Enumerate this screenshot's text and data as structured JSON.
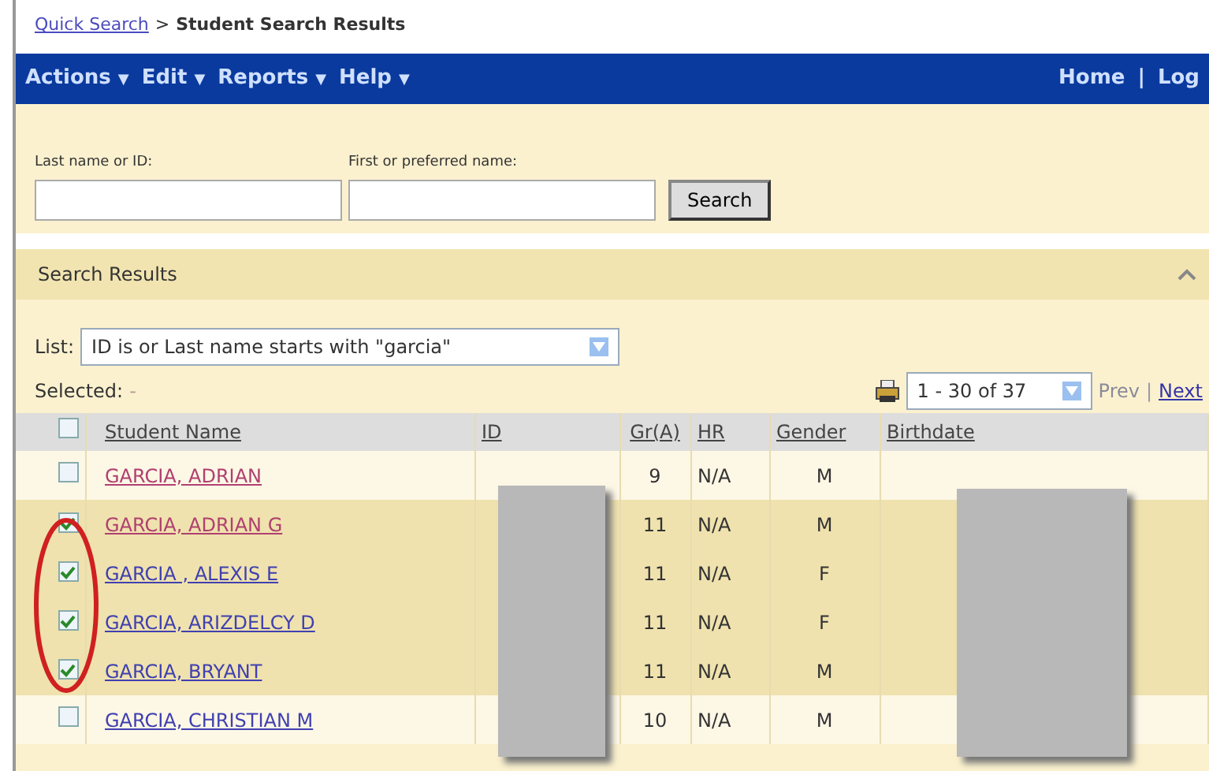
{
  "breadcrumb": {
    "link": "Quick Search",
    "separator": ">",
    "current": "Student Search Results"
  },
  "menu": [
    {
      "label": "Actions",
      "arrow": "▼"
    },
    {
      "label": "Edit",
      "arrow": "▼"
    },
    {
      "label": "Reports",
      "arrow": "▼"
    },
    {
      "label": "Help",
      "arrow": "▼"
    }
  ],
  "top_links": [
    "Home",
    "|",
    "Log"
  ],
  "search_form": {
    "fields": [
      {
        "label": "Last name or ID:"
      },
      {
        "label": "First or preferred name:"
      }
    ],
    "button": "Search"
  },
  "results_panel": {
    "title": "Search Results",
    "expanded": true,
    "list_label": "List:",
    "list_value": "ID is or Last name starts with \"garcia\"",
    "selected_label": "Selected:",
    "selected_value": "-",
    "pager": "1 - 30 of 37",
    "prev": "Prev",
    "pager_sep": "|",
    "next": "Next"
  },
  "table": {
    "header_checked": false,
    "columns": [
      "Student Name",
      "ID",
      "Gr(A)",
      "HR",
      "Gender",
      "Birthdate"
    ],
    "rows": [
      {
        "checked": false,
        "name": "GARCIA, ADRIAN",
        "grade": "9",
        "hr": "N/A",
        "gender": "M"
      },
      {
        "checked": true,
        "name": "GARCIA, ADRIAN G",
        "grade": "11",
        "hr": "N/A",
        "gender": "M"
      },
      {
        "checked": true,
        "name": "GARCIA , ALEXIS E",
        "grade": "11",
        "hr": "N/A",
        "gender": "F"
      },
      {
        "checked": true,
        "name": "GARCIA, ARIZDELCY D",
        "grade": "11",
        "hr": "N/A",
        "gender": "F"
      },
      {
        "checked": true,
        "name": "GARCIA, BRYANT",
        "grade": "11",
        "hr": "N/A",
        "gender": "M"
      },
      {
        "checked": false,
        "name": "GARCIA, CHRISTIAN M",
        "grade": "10",
        "hr": "N/A",
        "gender": "M"
      }
    ]
  }
}
